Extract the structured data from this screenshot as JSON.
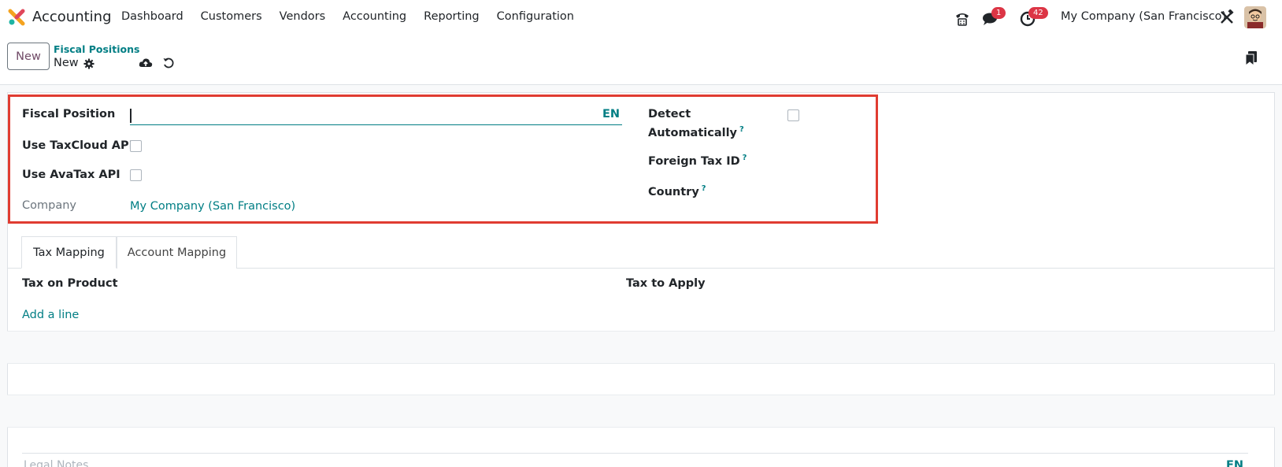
{
  "navbar": {
    "app_name": "Accounting",
    "menu": [
      "Dashboard",
      "Customers",
      "Vendors",
      "Accounting",
      "Reporting",
      "Configuration"
    ],
    "messages_count": "1",
    "activities_count": "42",
    "company": "My Company (San Francisco)"
  },
  "control": {
    "new_label": "New",
    "breadcrumb": "Fiscal Positions",
    "record": "New"
  },
  "form": {
    "fiscal_position_label": "Fiscal Position",
    "fiscal_position_value": "",
    "lang": "EN",
    "taxcloud_label": "Use TaxCloud API",
    "avatax_label": "Use AvaTax API",
    "company_label": "Company",
    "company_value": "My Company (San Francisco)",
    "detect_label_1": "Detect",
    "detect_label_2": "Automatically",
    "foreign_tax_label": "Foreign Tax ID",
    "country_label": "Country",
    "help_mark": "?"
  },
  "tabs": [
    "Tax Mapping",
    "Account Mapping"
  ],
  "table": {
    "col1": "Tax on Product",
    "col2": "Tax to Apply",
    "add_line": "Add a line"
  },
  "notes": {
    "placeholder": "Legal Notes...",
    "lang": "EN"
  },
  "colors": {
    "accent": "#017e84",
    "brand": "#714b67",
    "highlight": "#e03c31",
    "badge": "#dc3545"
  }
}
